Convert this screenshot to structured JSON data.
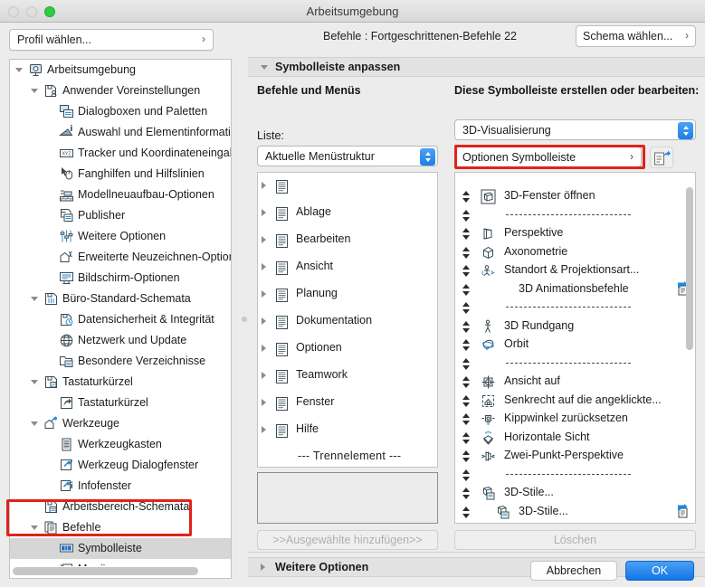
{
  "window": {
    "title": "Arbeitsumgebung",
    "traffic_lights": [
      "close",
      "minimize",
      "maximize"
    ]
  },
  "left": {
    "profile_popup": {
      "label": "Profil wählen...",
      "chevron": "›"
    },
    "tree": [
      {
        "label": "Arbeitsumgebung",
        "depth": 0,
        "twisty": "down",
        "icon": "workspace-icon",
        "selected": false
      },
      {
        "label": "Anwender Voreinstellungen",
        "depth": 1,
        "twisty": "down",
        "icon": "user-prefs-icon",
        "selected": false
      },
      {
        "label": "Dialogboxen und Paletten",
        "depth": 2,
        "twisty": "none",
        "icon": "dialogs-icon",
        "selected": false
      },
      {
        "label": "Auswahl und Elementinformationen",
        "depth": 2,
        "twisty": "none",
        "icon": "selection-info-icon",
        "selected": false
      },
      {
        "label": "Tracker und Koordinateneingabe",
        "depth": 2,
        "twisty": "none",
        "icon": "tracker-xyz-icon",
        "selected": false
      },
      {
        "label": "Fanghilfen und Hilfslinien",
        "depth": 2,
        "twisty": "none",
        "icon": "snap-guides-icon",
        "selected": false
      },
      {
        "label": "Modellneuaufbau-Optionen",
        "depth": 2,
        "twisty": "none",
        "icon": "rebuild-icon",
        "selected": false
      },
      {
        "label": "Publisher",
        "depth": 2,
        "twisty": "none",
        "icon": "publisher-icon",
        "selected": false
      },
      {
        "label": "Weitere Optionen",
        "depth": 2,
        "twisty": "none",
        "icon": "sliders-icon",
        "selected": false
      },
      {
        "label": "Erweiterte Neuzeichnen-Optionen",
        "depth": 2,
        "twisty": "none",
        "icon": "redraw-icon",
        "selected": false
      },
      {
        "label": "Bildschirm-Optionen",
        "depth": 2,
        "twisty": "none",
        "icon": "screen-icon",
        "selected": false
      },
      {
        "label": "Büro-Standard-Schemata",
        "depth": 1,
        "twisty": "down",
        "icon": "office-schema-icon",
        "selected": false
      },
      {
        "label": "Datensicherheit & Integrität",
        "depth": 2,
        "twisty": "none",
        "icon": "data-safety-icon",
        "selected": false
      },
      {
        "label": "Netzwerk und Update",
        "depth": 2,
        "twisty": "none",
        "icon": "globe-icon",
        "selected": false
      },
      {
        "label": "Besondere Verzeichnisse",
        "depth": 2,
        "twisty": "none",
        "icon": "folder-icon",
        "selected": false
      },
      {
        "label": "Tastaturkürzel",
        "depth": 1,
        "twisty": "down",
        "icon": "shortcut-schema-icon",
        "selected": false
      },
      {
        "label": "Tastaturkürzel",
        "depth": 2,
        "twisty": "none",
        "icon": "shortcut-arrow-icon",
        "selected": false
      },
      {
        "label": "Werkzeuge",
        "depth": 1,
        "twisty": "down",
        "icon": "tools-icon",
        "selected": false
      },
      {
        "label": "Werkzeugkasten",
        "depth": 2,
        "twisty": "none",
        "icon": "toolbox-icon",
        "selected": false
      },
      {
        "label": "Werkzeug Dialogfenster",
        "depth": 2,
        "twisty": "none",
        "icon": "tool-dialog-icon",
        "selected": false
      },
      {
        "label": "Infofenster",
        "depth": 2,
        "twisty": "none",
        "icon": "info-window-icon",
        "selected": false
      },
      {
        "label": "Arbeitsbereich-Schemata",
        "depth": 1,
        "twisty": "none",
        "icon": "workspace-schema-icon",
        "selected": false
      },
      {
        "label": "Befehle",
        "depth": 1,
        "twisty": "down",
        "icon": "commands-icon",
        "selected": false
      },
      {
        "label": "Symbolleiste",
        "depth": 2,
        "twisty": "none",
        "icon": "toolbar-icon",
        "selected": true
      },
      {
        "label": "Menüs",
        "depth": 2,
        "twisty": "none",
        "icon": "menus-icon",
        "selected": false
      }
    ]
  },
  "right": {
    "command_header": "Befehle :  Fortgeschrittenen-Befehle 22",
    "schema_popup": {
      "label": "Schema wählen...",
      "chevron": "›"
    },
    "section_customize": {
      "title": "Symbolleiste anpassen",
      "state": "expanded"
    },
    "section_more_options": {
      "title": "Weitere Optionen",
      "state": "collapsed"
    },
    "left_column_heading": "Befehle und Menüs",
    "right_column_heading": "Diese Symbolleiste erstellen oder bearbeiten:",
    "liste_label": "Liste:",
    "menu_structure_popup": "Aktuelle Menüstruktur",
    "toolbar_select_popup": "3D-Visualisierung",
    "options_toolbar_button": {
      "label": "Optionen Symbolleiste",
      "chevron": "›"
    },
    "add_button": ">>Ausgewählte hinzufügen>>",
    "delete_button": "Löschen",
    "menu_tree": [
      {
        "label": "",
        "icon": "menu-icon",
        "twisty": "right"
      },
      {
        "label": "Ablage",
        "icon": "menu-icon",
        "twisty": "right"
      },
      {
        "label": "Bearbeiten",
        "icon": "menu-icon",
        "twisty": "right"
      },
      {
        "label": "Ansicht",
        "icon": "menu-icon",
        "twisty": "right"
      },
      {
        "label": "Planung",
        "icon": "menu-icon",
        "twisty": "right"
      },
      {
        "label": "Dokumentation",
        "icon": "menu-icon",
        "twisty": "right"
      },
      {
        "label": "Optionen",
        "icon": "menu-icon",
        "twisty": "right"
      },
      {
        "label": "Teamwork",
        "icon": "menu-icon",
        "twisty": "right"
      },
      {
        "label": "Fenster",
        "icon": "menu-icon",
        "twisty": "right"
      },
      {
        "label": "Hilfe",
        "icon": "menu-icon",
        "twisty": "right"
      },
      {
        "label": "--- Trennelement ---",
        "icon": "none",
        "twisty": "none"
      }
    ],
    "toolbar_items": [
      {
        "label": "3D-Fenster öffnen",
        "icon": "3d-window-icon",
        "type": "item",
        "indent": 0,
        "extra": false
      },
      {
        "label": "",
        "icon": "none",
        "type": "separator",
        "indent": 0,
        "extra": false
      },
      {
        "label": "Perspektive",
        "icon": "perspective-icon",
        "type": "item",
        "indent": 0,
        "extra": false
      },
      {
        "label": "Axonometrie",
        "icon": "axonometry-icon",
        "type": "item",
        "indent": 0,
        "extra": false
      },
      {
        "label": "Standort & Projektionsart...",
        "icon": "projection-icon",
        "type": "item",
        "indent": 0,
        "extra": false
      },
      {
        "label": "3D Animationsbefehle",
        "icon": "none",
        "type": "item",
        "indent": 1,
        "extra": true
      },
      {
        "label": "",
        "icon": "none",
        "type": "separator",
        "indent": 0,
        "extra": false
      },
      {
        "label": "3D Rundgang",
        "icon": "walk-icon",
        "type": "item",
        "indent": 0,
        "extra": false
      },
      {
        "label": "Orbit",
        "icon": "orbit-icon",
        "type": "item",
        "indent": 0,
        "extra": false
      },
      {
        "label": "",
        "icon": "none",
        "type": "separator",
        "indent": 0,
        "extra": false
      },
      {
        "label": "Ansicht auf",
        "icon": "view-on-icon",
        "type": "item",
        "indent": 0,
        "extra": false
      },
      {
        "label": "Senkrecht auf die angeklickte...",
        "icon": "perpendicular-icon",
        "type": "item",
        "indent": 0,
        "extra": false
      },
      {
        "label": "Kippwinkel zurücksetzen",
        "icon": "reset-tilt-icon",
        "type": "item",
        "indent": 0,
        "extra": false
      },
      {
        "label": "Horizontale Sicht",
        "icon": "horizontal-view-icon",
        "type": "item",
        "indent": 0,
        "extra": false
      },
      {
        "label": "Zwei-Punkt-Perspektive",
        "icon": "two-point-persp-icon",
        "type": "item",
        "indent": 0,
        "extra": false
      },
      {
        "label": "",
        "icon": "none",
        "type": "separator",
        "indent": 0,
        "extra": false
      },
      {
        "label": "3D-Stile...",
        "icon": "3d-styles-icon",
        "type": "item",
        "indent": 0,
        "extra": false
      },
      {
        "label": "3D-Stile...",
        "icon": "3d-styles-icon",
        "type": "item",
        "indent": 1,
        "extra": true
      }
    ]
  },
  "footer": {
    "cancel": "Abbrechen",
    "ok": "OK"
  },
  "annotations": {
    "highlight_color": "#e0231a",
    "boxes": [
      "options-toolbar-button",
      "sidebar-befehle-symbolleiste"
    ]
  }
}
